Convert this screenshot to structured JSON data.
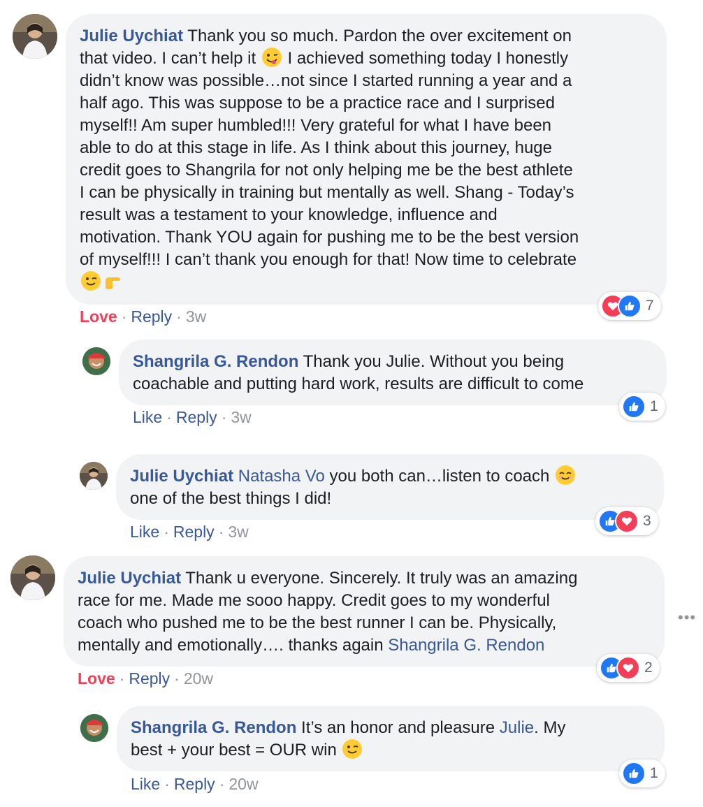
{
  "comments": [
    {
      "author": "Julie Uychiat",
      "text_a": " Thank you so much. Pardon the over excitement on\nthat video. I can’t help it ",
      "emoji_a": "winking-tongue-emoji",
      "text_b": " I achieved something today I honestly\ndidn’t know was possible…not since I started running a year and a\nhalf ago. This was suppose to be a practice race and I surprised\nmyself!! Am super humbled!!! Very grateful for what I have been\nable to do at this stage in life. As I think about this journey, huge\ncredit goes to Shangrila for not only helping me be the best athlete\nI can be physically in training but mentally as well. Shang - Today’s\nresult was a testament to your knowledge, influence and\nmotivation. Thank YOU again for pushing me to be the best version\nof myself!!! I can’t thank you enough for that! Now time to celebrate\n",
      "emoji_b": "winking-face-emoji",
      "emoji_c": "pointing-hand-emoji",
      "action_react": "Love",
      "action_reply": "Reply",
      "time": "3w",
      "reaction_count": "7",
      "reaction_icons": [
        "love",
        "like"
      ]
    },
    {
      "author": "Shangrila G. Rendon",
      "text_a": " Thank you Julie. Without you being\ncoachable and putting hard work, results are difficult to come",
      "action_react": "Like",
      "action_reply": "Reply",
      "time": "3w",
      "reaction_count": "1",
      "reaction_icons": [
        "like"
      ]
    },
    {
      "author": "Julie Uychiat",
      "mention": "Natasha Vo",
      "text_a": " you both can…listen to coach ",
      "emoji_a": "smiling-face-emoji",
      "text_b": "\none of the best things I did!",
      "action_react": "Like",
      "action_reply": "Reply",
      "time": "3w",
      "reaction_count": "3",
      "reaction_icons": [
        "like",
        "love"
      ]
    },
    {
      "author": "Julie Uychiat",
      "text_a": " Thank u everyone. Sincerely. It truly was an amazing\nrace for me. Made me sooo happy. Credit goes to my wonderful\ncoach who pushed me to be the best runner I can be. Physically,\nmentally and emotionally…. thanks again ",
      "mention_end": "Shangrila G. Rendon",
      "action_react": "Love",
      "action_reply": "Reply",
      "time": "20w",
      "reaction_count": "2",
      "reaction_icons": [
        "like",
        "love"
      ]
    },
    {
      "author": "Shangrila G. Rendon",
      "text_a": " It’s an honor and pleasure ",
      "mention_mid": "Julie",
      "text_b": ". My\nbest + your best = OUR win ",
      "emoji_a": "winking-face-emoji",
      "action_react": "Like",
      "action_reply": "Reply",
      "time": "20w",
      "reaction_count": "1",
      "reaction_icons": [
        "like"
      ]
    }
  ],
  "more_options": "•••",
  "colors": {
    "link": "#385898",
    "love": "#f33e58",
    "like": "#2078f4",
    "bubble": "#f2f3f5",
    "meta": "#90949c"
  }
}
